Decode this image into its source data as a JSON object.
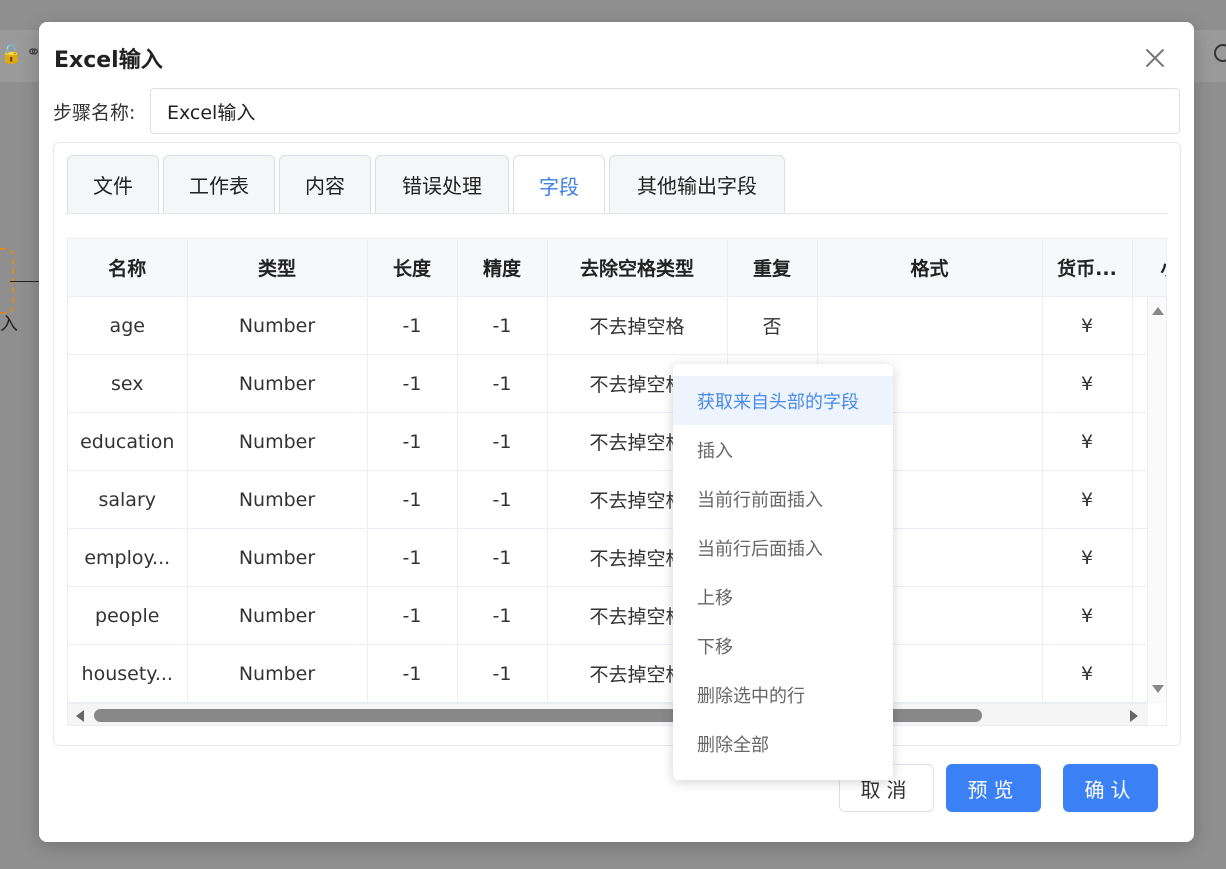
{
  "dialog": {
    "title": "Excel输入"
  },
  "step": {
    "label": "步骤名称:",
    "value": "Excel输入"
  },
  "tabs": [
    {
      "label": "文件",
      "active": false
    },
    {
      "label": "工作表",
      "active": false
    },
    {
      "label": "内容",
      "active": false
    },
    {
      "label": "错误处理",
      "active": false
    },
    {
      "label": "字段",
      "active": true
    },
    {
      "label": "其他输出字段",
      "active": false
    }
  ],
  "table": {
    "headers": [
      "名称",
      "类型",
      "长度",
      "精度",
      "去除空格类型",
      "重复",
      "格式",
      "货币...",
      "小"
    ],
    "rows": [
      [
        "age",
        "Number",
        "-1",
        "-1",
        "不去掉空格",
        "否",
        "",
        "¥",
        ""
      ],
      [
        "sex",
        "Number",
        "-1",
        "-1",
        "不去掉空格",
        "",
        "",
        "¥",
        ""
      ],
      [
        "education",
        "Number",
        "-1",
        "-1",
        "不去掉空格",
        "",
        "",
        "¥",
        ""
      ],
      [
        "salary",
        "Number",
        "-1",
        "-1",
        "不去掉空格",
        "",
        "",
        "¥",
        ""
      ],
      [
        "employ...",
        "Number",
        "-1",
        "-1",
        "不去掉空格",
        "",
        "",
        "¥",
        ""
      ],
      [
        "people",
        "Number",
        "-1",
        "-1",
        "不去掉空格",
        "",
        "",
        "¥",
        ""
      ],
      [
        "housety...",
        "Number",
        "-1",
        "-1",
        "不去掉空格",
        "",
        "",
        "¥",
        ""
      ]
    ]
  },
  "context_menu": {
    "items": [
      "获取来自头部的字段",
      "插入",
      "当前行前面插入",
      "当前行后面插入",
      "上移",
      "下移",
      "删除选中的行",
      "删除全部"
    ]
  },
  "footer": {
    "cancel": "取消",
    "preview": "预览",
    "confirm": "确认"
  },
  "background": {
    "node_label": "入"
  },
  "colors": {
    "accent": "#3c80f5",
    "active_tab_text": "#3a7ee6",
    "menu_hover_bg": "#eef4fe",
    "menu_hover_text": "#4a8ae8"
  }
}
